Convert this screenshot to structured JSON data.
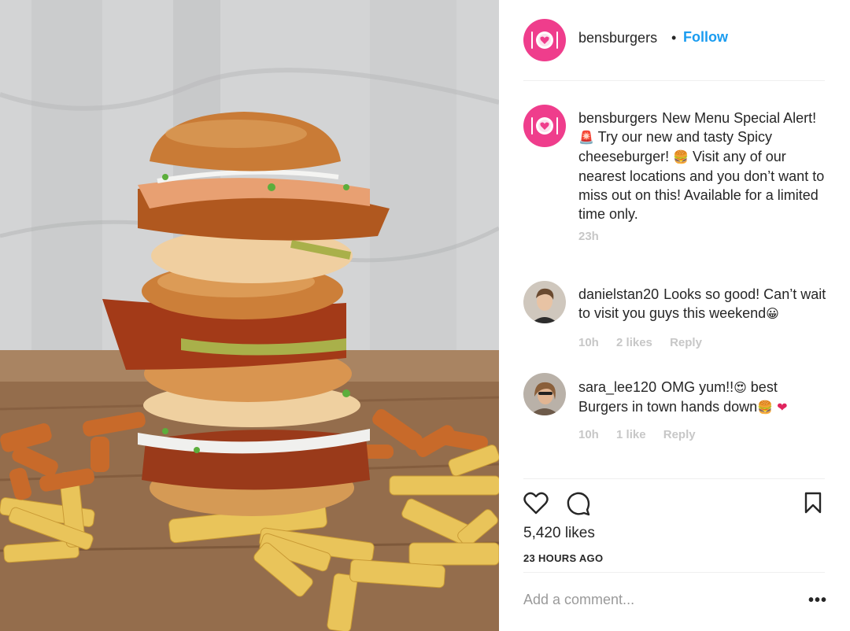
{
  "post": {
    "image_alt": "Stacked spicy chicken cheeseburgers with fries",
    "header": {
      "username": "bensburgers",
      "separator": "•",
      "follow_label": "Follow"
    },
    "caption": {
      "username": "bensburgers",
      "text_1": "New Menu Special Alert! ",
      "emoji_1": "🚨",
      "text_2": " Try our new and tasty Spicy cheeseburger! ",
      "emoji_2": "🍔",
      "text_3": " Visit any of our nearest locations and you don’t want to miss out on this! Available for a limited time only.",
      "time": "23h"
    },
    "comments": [
      {
        "username": "danielstan20",
        "text": "Looks so good! Can’t wait to visit you guys this weekend",
        "emoji": "😀",
        "time": "10h",
        "likes": "2 likes",
        "reply": "Reply"
      },
      {
        "username": "sara_lee120",
        "text_1": "OMG yum!!",
        "emoji_1": "😍",
        "text_2": " best Burgers in town hands down",
        "emoji_2": "🍔",
        "emoji_3": "❤",
        "time": "10h",
        "likes": "1 like",
        "reply": "Reply"
      }
    ],
    "actions": {
      "like_icon": "heart-icon",
      "comment_icon": "comment-icon",
      "save_icon": "bookmark-icon"
    },
    "likes_count": "5,420 likes",
    "posted_ago": "23 HOURS AGO",
    "add_comment_placeholder": "Add a comment...",
    "more_label": "•••"
  },
  "colors": {
    "brand_pink": "#ef3d8c",
    "follow_blue": "#1a9cf0",
    "muted": "#c7c7c7",
    "heart_red": "#e0245e"
  }
}
